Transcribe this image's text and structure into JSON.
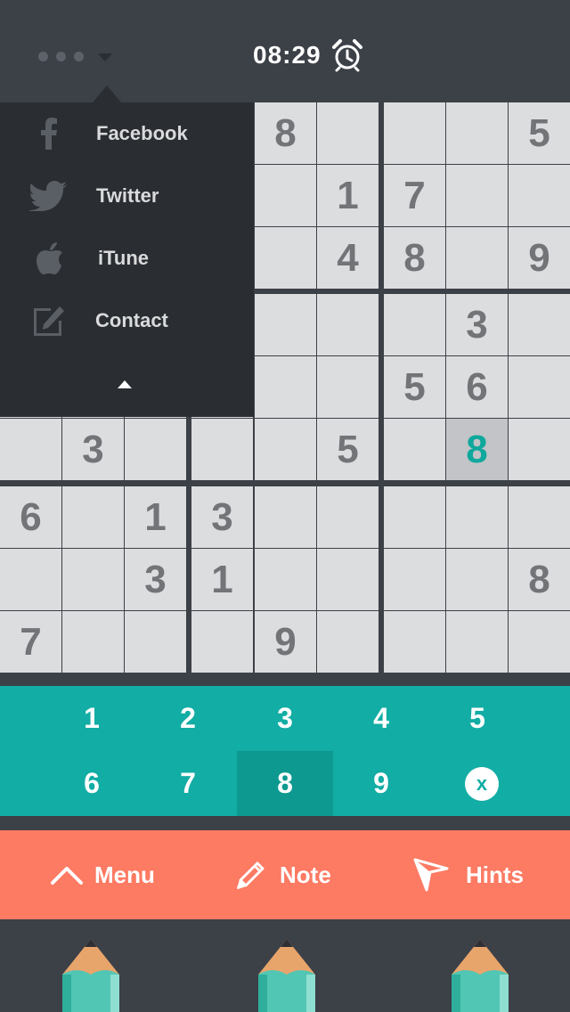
{
  "header": {
    "time": "08:29",
    "more_icon": "dots-dropdown-icon",
    "alarm_icon": "alarm-clock-icon"
  },
  "menu": {
    "items": [
      {
        "label": "Facebook",
        "icon": "facebook-icon"
      },
      {
        "label": "Twitter",
        "icon": "twitter-icon"
      },
      {
        "label": "iTune",
        "icon": "apple-icon"
      },
      {
        "label": "Contact",
        "icon": "edit-icon"
      }
    ],
    "collapse_icon": "caret-up-icon"
  },
  "board": {
    "rows": [
      [
        "",
        "",
        "",
        "",
        "8",
        "",
        "",
        "",
        "5"
      ],
      [
        "",
        "",
        "",
        "",
        "",
        "1",
        "7",
        "",
        ""
      ],
      [
        "",
        "",
        "",
        "",
        "",
        "4",
        "8",
        "",
        "9"
      ],
      [
        "",
        "",
        "",
        "",
        "",
        "",
        "",
        "3",
        ""
      ],
      [
        "",
        "",
        "",
        "",
        "",
        "",
        "5",
        "6",
        ""
      ],
      [
        "",
        "3",
        "",
        "",
        "",
        "5",
        "",
        "8",
        ""
      ],
      [
        "6",
        "",
        "1",
        "3",
        "",
        "",
        "",
        "",
        ""
      ],
      [
        "",
        "",
        "3",
        "1",
        "",
        "",
        "",
        "",
        "8"
      ],
      [
        "7",
        "",
        "",
        "",
        "9",
        "",
        "",
        "",
        ""
      ]
    ],
    "selected": {
      "row": 5,
      "col": 7
    },
    "accent_color": "#10a89d"
  },
  "keypad": {
    "keys": [
      "1",
      "2",
      "3",
      "4",
      "5",
      "6",
      "7",
      "8",
      "9"
    ],
    "selected_key": "8",
    "clear_label": "x",
    "color": "#12ada4"
  },
  "actions": {
    "menu_label": "Menu",
    "note_label": "Note",
    "hints_label": "Hints",
    "color": "#fd7a63"
  },
  "pencils": [
    "pencil-icon",
    "pencil-icon",
    "pencil-icon"
  ]
}
